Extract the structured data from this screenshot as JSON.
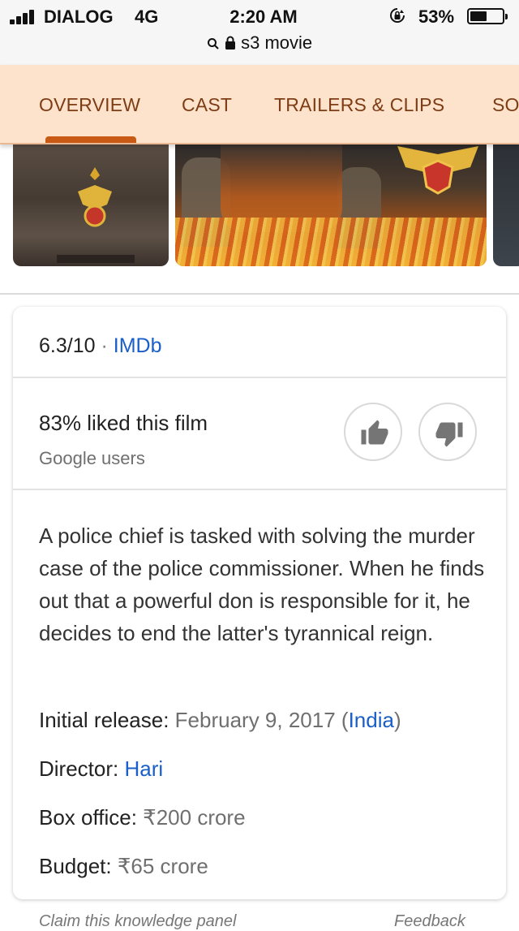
{
  "status_bar": {
    "carrier": "DIALOG",
    "network": "4G",
    "time": "2:20 AM",
    "battery_percent": "53%",
    "battery_level": 0.53,
    "url": "s3 movie"
  },
  "tabs": [
    {
      "label": "OVERVIEW",
      "active": true
    },
    {
      "label": "CAST",
      "active": false
    },
    {
      "label": "TRAILERS & CLIPS",
      "active": false
    },
    {
      "label": "SO",
      "active": false
    }
  ],
  "colors": {
    "accent": "#c85a16",
    "tab_bar": "#fde3cc",
    "tab_text": "#7e3c14",
    "link": "#1a5fc8"
  },
  "rating": {
    "score": "6.3/10",
    "separator": "·",
    "source": "IMDb"
  },
  "audience": {
    "liked": "83% liked this film",
    "subtitle": "Google users"
  },
  "description": "A police chief is tasked with solving the murder case of the police commissioner. When he finds out that a powerful don is responsible for it, he decides to end the latter's tyrannical reign.",
  "facts": {
    "release": {
      "label": "Initial release:",
      "value": "February 9, 2017",
      "open": " (",
      "link": "India",
      "close": ")"
    },
    "director": {
      "label": "Director:",
      "value": "Hari"
    },
    "box_office": {
      "label": "Box office:",
      "value": "₹200 crore"
    },
    "budget": {
      "label": "Budget:",
      "value": "₹65 crore"
    }
  },
  "footer": {
    "left": "Claim this knowledge panel",
    "right": "Feedback"
  }
}
